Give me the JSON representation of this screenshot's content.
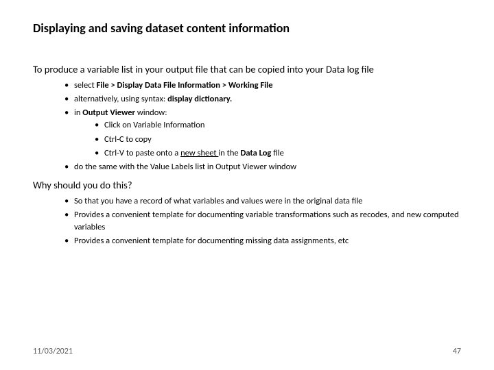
{
  "title": "Displaying and saving dataset content information",
  "lead": "To produce a variable list in your output file that can be copied into your Data log file",
  "b1": {
    "i1_pre": "select ",
    "i1_bold": "File > Display Data File Information > Working File",
    "i2_pre": "alternatively, using syntax: ",
    "i2_bold": "display dictionary.",
    "i3_pre": "in ",
    "i3_bold": "Output Viewer ",
    "i3_post": "window:",
    "i3a": "Click on Variable Information",
    "i3b": "Ctrl-C to copy",
    "i3c_pre": "Ctrl-V to paste onto a ",
    "i3c_u": "new sheet ",
    "i3c_mid": "in the ",
    "i3c_bold": "Data Log ",
    "i3c_post": "file",
    "i4": "do the same with the Value Labels list in Output Viewer window"
  },
  "qhead": "Why should you do this?",
  "b2": {
    "i1": "So that you have a record of what variables and values were in the original data file",
    "i2": "Provides a convenient template for documenting variable transformations such as recodes, and new computed variables",
    "i3": "Provides a convenient template for documenting missing data assignments, etc"
  },
  "footer": {
    "date": "11/03/2021",
    "page": "47"
  }
}
